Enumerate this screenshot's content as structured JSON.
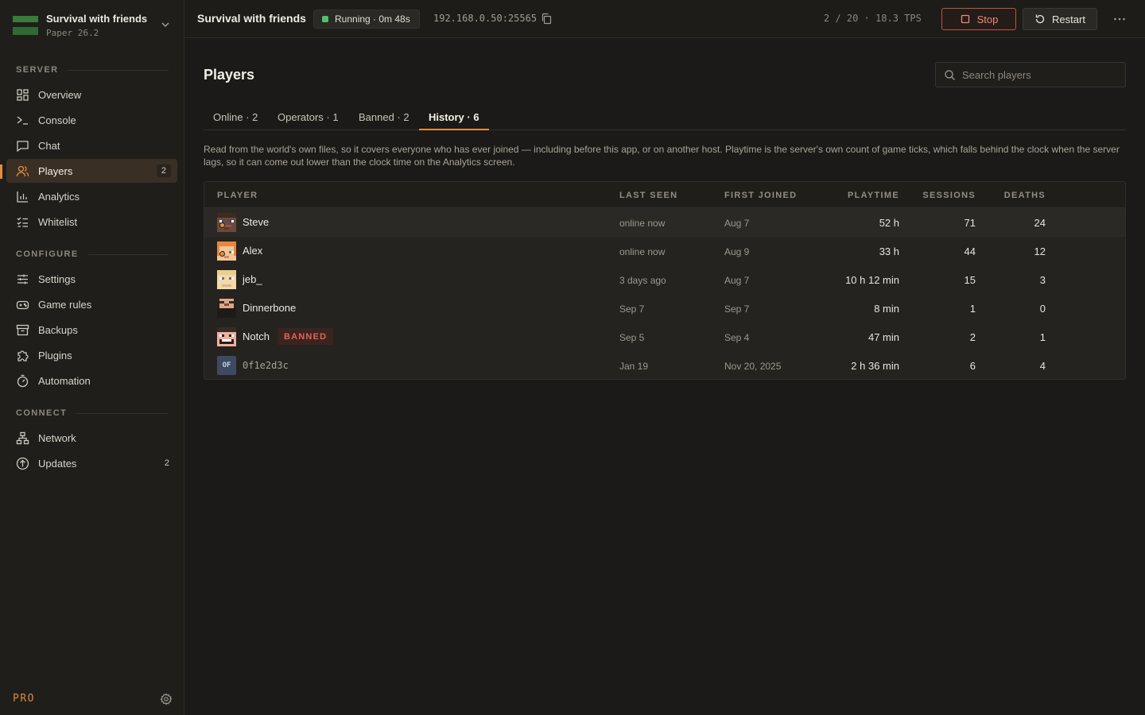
{
  "sidebar": {
    "server": {
      "name": "Survival with friends",
      "version": "Paper 26.2"
    },
    "sections": [
      {
        "label": "SERVER"
      },
      {
        "label": "CONFIGURE"
      },
      {
        "label": "CONNECT"
      }
    ],
    "items": [
      {
        "label": "Overview",
        "icon": "grid-icon"
      },
      {
        "label": "Console",
        "icon": "terminal-icon"
      },
      {
        "label": "Chat",
        "icon": "chat-icon"
      },
      {
        "label": "Players",
        "icon": "users-icon",
        "count": "2",
        "active": true
      },
      {
        "label": "Analytics",
        "icon": "bar-chart-icon"
      },
      {
        "label": "Whitelist",
        "icon": "list-check-icon"
      },
      {
        "label": "Settings",
        "icon": "sliders-icon"
      },
      {
        "label": "Game rules",
        "icon": "gamepad-icon"
      },
      {
        "label": "Backups",
        "icon": "archive-icon"
      },
      {
        "label": "Plugins",
        "icon": "puzzle-icon"
      },
      {
        "label": "Automation",
        "icon": "timer-icon"
      },
      {
        "label": "Network",
        "icon": "network-icon"
      },
      {
        "label": "Updates",
        "icon": "arrow-up-circle-icon",
        "count": "2"
      }
    ],
    "footer": {
      "plan": "PRO"
    }
  },
  "topbar": {
    "title": "Survival with friends",
    "status": "Running · 0m 48s",
    "address": "192.168.0.50:25565",
    "stats": "2 / 20 · 18.3 TPS",
    "stop_label": "Stop",
    "restart_label": "Restart"
  },
  "page": {
    "title": "Players",
    "search_placeholder": "Search players",
    "tabs": [
      {
        "label": "Online · 2"
      },
      {
        "label": "Operators · 1"
      },
      {
        "label": "Banned · 2"
      },
      {
        "label": "History · 6",
        "active": true
      }
    ],
    "description": "Read from the world's own files, so it covers everyone who has ever joined — including before this app, or on another host. Playtime is the server's own count of game ticks, which falls behind the clock when the server lags, so it can come out lower than the clock time on the Analytics screen."
  },
  "table": {
    "columns": [
      "PLAYER",
      "LAST SEEN",
      "FIRST JOINED",
      "PLAYTIME",
      "SESSIONS",
      "DEATHS"
    ],
    "rows": [
      {
        "player": "Steve",
        "last_seen": "online now",
        "first_joined": "Aug 7",
        "playtime": "52 h",
        "sessions": "71",
        "deaths": "24",
        "online": true
      },
      {
        "player": "Alex",
        "last_seen": "online now",
        "first_joined": "Aug 9",
        "playtime": "33 h",
        "sessions": "44",
        "deaths": "12",
        "online": true
      },
      {
        "player": "jeb_",
        "last_seen": "3 days ago",
        "first_joined": "Aug 7",
        "playtime": "10 h 12 min",
        "sessions": "15",
        "deaths": "3"
      },
      {
        "player": "Dinnerbone",
        "last_seen": "Sep 7",
        "first_joined": "Sep 7",
        "playtime": "8 min",
        "sessions": "1",
        "deaths": "0"
      },
      {
        "player": "Notch",
        "badge": "BANNED",
        "last_seen": "Sep 5",
        "first_joined": "Sep 4",
        "playtime": "47 min",
        "sessions": "2",
        "deaths": "1"
      },
      {
        "player": "0f1e2d3c",
        "avatar_text": "OF",
        "last_seen": "Jan 19",
        "first_joined": "Nov 20, 2025",
        "playtime": "2 h 36 min",
        "sessions": "6",
        "deaths": "4"
      }
    ]
  },
  "colors": {
    "accent": "#e38d3f",
    "running": "#4fc36b",
    "danger": "#e0664f"
  }
}
